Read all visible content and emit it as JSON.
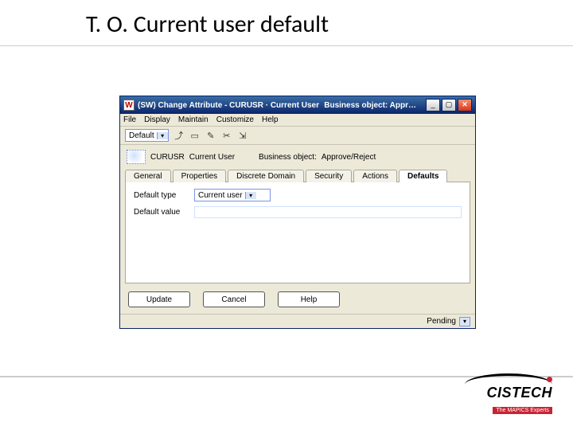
{
  "slide": {
    "title": "T. O. Current user default"
  },
  "window": {
    "icon_text": "W",
    "title": "(SW) Change Attribute - CURUSR · Current User",
    "title_right": "Business object:  Appr…"
  },
  "menu": {
    "file": "File",
    "display": "Display",
    "maintain": "Maintain",
    "customize": "Customize",
    "help": "Help"
  },
  "toolbar": {
    "dropdown_value": "Default",
    "icons": {
      "open": "⤴",
      "blank": "▭",
      "edit": "✎",
      "cut": "✂",
      "link": "⇲"
    }
  },
  "info": {
    "code_label": "CURUSR",
    "code_desc": "Current User",
    "bo_label": "Business object:",
    "bo_value": "Approve/Reject"
  },
  "tabs": {
    "general": "General",
    "properties": "Properties",
    "discrete": "Discrete Domain",
    "security": "Security",
    "actions": "Actions",
    "defaults": "Defaults"
  },
  "form": {
    "default_type_label": "Default type",
    "default_type_value": "Current user",
    "default_value_label": "Default value"
  },
  "buttons": {
    "update": "Update",
    "cancel": "Cancel",
    "help": "Help"
  },
  "status": {
    "text": "Pending"
  },
  "logo": {
    "word": "CISTECH",
    "tag": "The MAPICS Experts"
  }
}
